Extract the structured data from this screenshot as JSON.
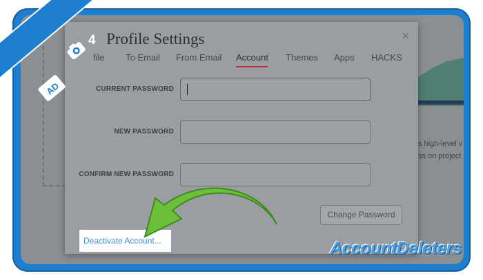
{
  "dialog": {
    "title": "Profile Settings",
    "close_glyph": "×"
  },
  "tabs": [
    {
      "label": "file"
    },
    {
      "label": "To Email"
    },
    {
      "label": "From Email"
    },
    {
      "label": "Account"
    },
    {
      "label": "Themes"
    },
    {
      "label": "Apps"
    },
    {
      "label": "HACKS"
    }
  ],
  "active_tab": "Account",
  "form": {
    "current_password_label": "CURRENT PASSWORD",
    "new_password_label": "NEW PASSWORD",
    "confirm_password_label": "CONFIRM NEW PASSWORD",
    "current_password_value": "",
    "new_password_value": "",
    "confirm_password_value": "",
    "change_password_button": "Change Password"
  },
  "deactivate_link": "Deactivate Account...",
  "background": {
    "snippet_1": "s high-level v",
    "snippet_2": "ss on project"
  },
  "overlay": {
    "step_number": "4",
    "ribbon_text": "AD",
    "logo": "AccountDeleters"
  },
  "colors": {
    "frame_blue": "#1e7fd0",
    "active_tab_underline": "#b4303a",
    "link_blue": "#3a8fd6",
    "arrow_green": "#6cbf3a"
  },
  "icons": {
    "close": "close-icon",
    "camera": "camera-icon",
    "arrow": "curved-arrow-icon"
  }
}
